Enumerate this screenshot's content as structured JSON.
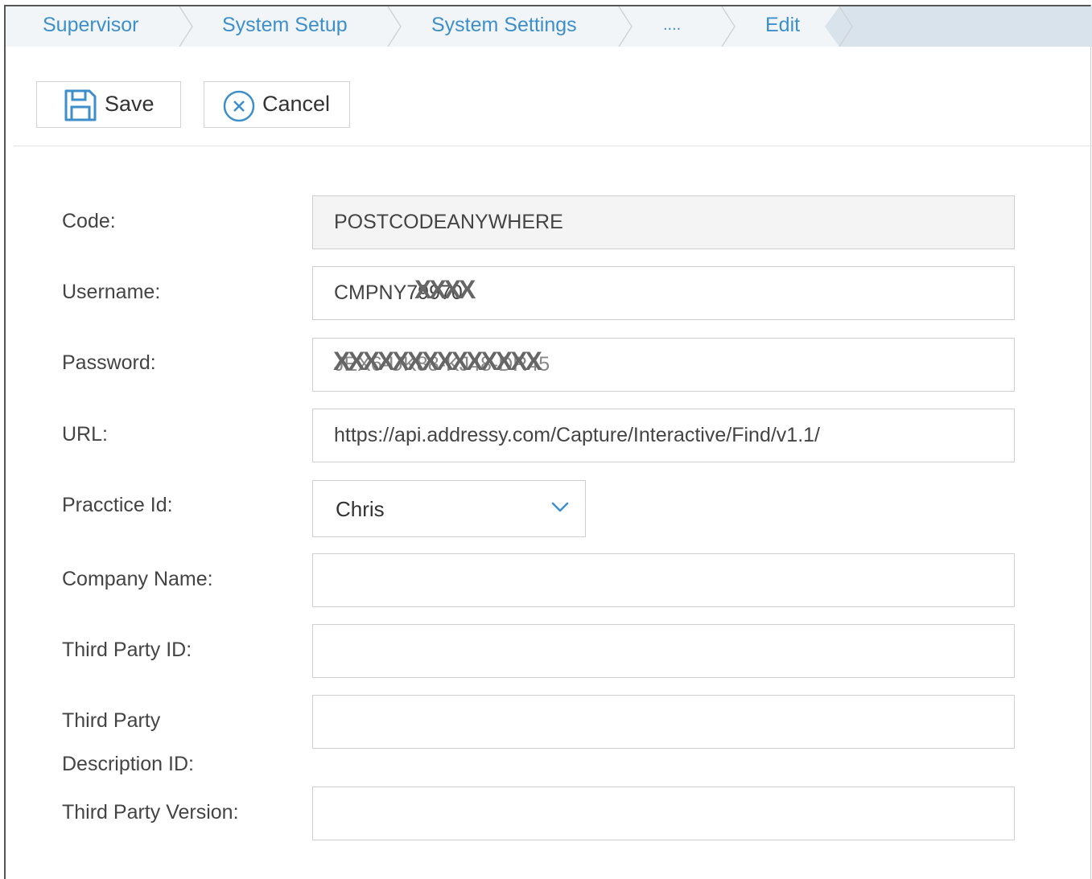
{
  "breadcrumb": {
    "items": [
      {
        "label": "Supervisor"
      },
      {
        "label": "System Setup"
      },
      {
        "label": "System Settings"
      },
      {
        "label": "...."
      },
      {
        "label": "Edit"
      }
    ]
  },
  "toolbar": {
    "save_label": "Save",
    "cancel_label": "Cancel",
    "save_icon": "save-icon",
    "cancel_icon": "cancel-circle-icon"
  },
  "form": {
    "code": {
      "label": "Code:",
      "value": "POSTCODEANYWHERE"
    },
    "username": {
      "label": "Username:",
      "value": "CMPNY79970",
      "redaction": "XXXX"
    },
    "password": {
      "label": "Password:",
      "value": "JEX6-UK88-KJ48-DR45",
      "redaction": "XXXXXXXXXXXXXX"
    },
    "url": {
      "label": "URL:",
      "value": "https://api.addressy.com/Capture/Interactive/Find/v1.1/"
    },
    "practice_id": {
      "label": "Pracctice Id:",
      "value": "Chris"
    },
    "company_name": {
      "label": "Company Name:",
      "value": ""
    },
    "third_party_id": {
      "label": "Third Party ID:",
      "value": ""
    },
    "third_party_description_id": {
      "label_line1": "Third Party",
      "label_line2": "Description ID:",
      "value": ""
    },
    "third_party_version": {
      "label": "Third Party Version:",
      "value": ""
    }
  },
  "colors": {
    "accent": "#3d8fcc",
    "breadcrumb_bg": "#d9e3ec",
    "label_text": "#444444",
    "border": "#cfcfcf"
  }
}
